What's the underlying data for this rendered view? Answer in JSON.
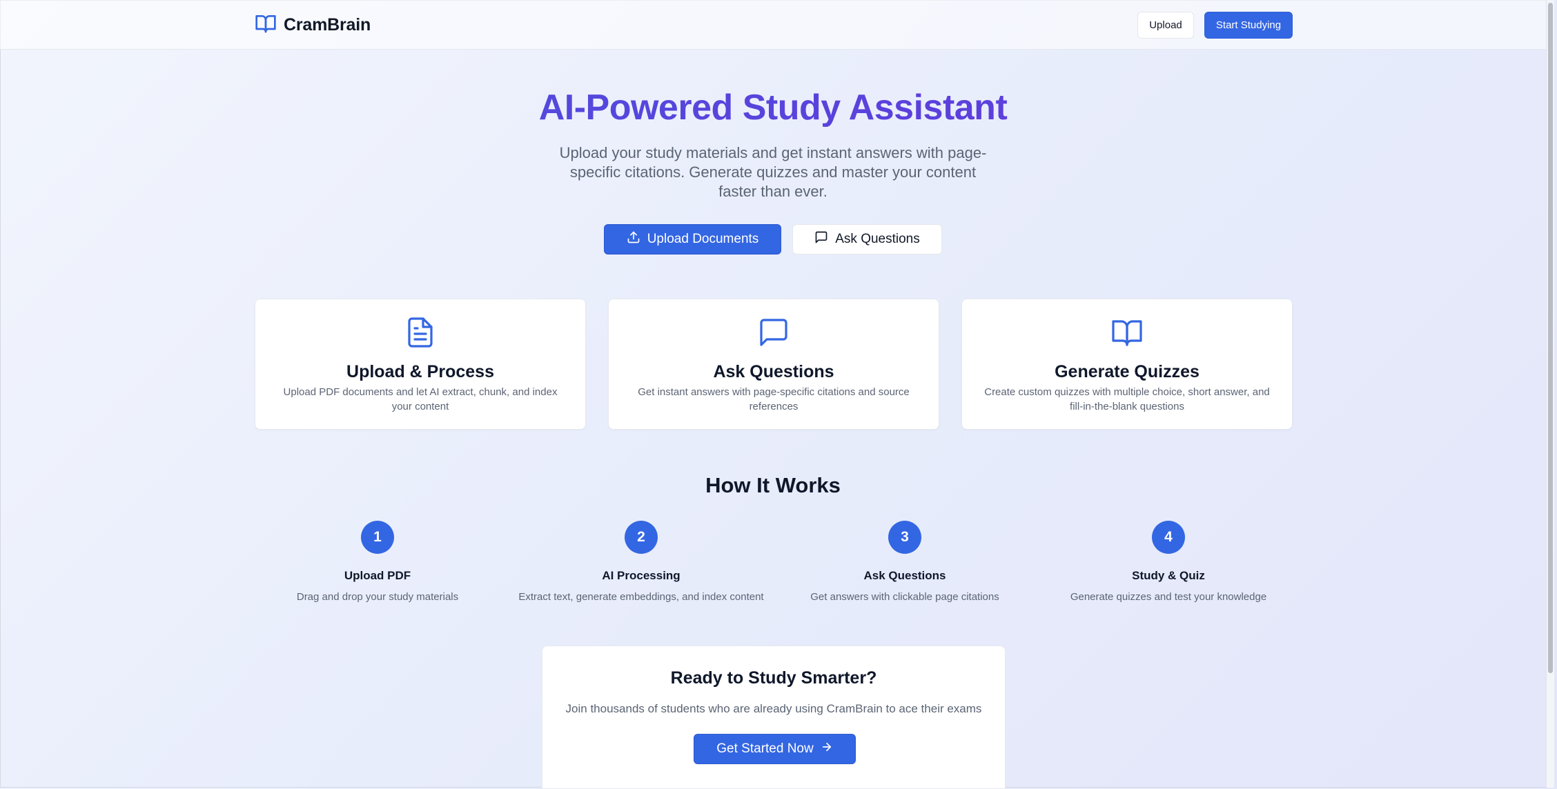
{
  "header": {
    "brand": "CramBrain",
    "upload_label": "Upload",
    "start_label": "Start Studying"
  },
  "hero": {
    "title": "AI-Powered Study Assistant",
    "subtitle": "Upload your study materials and get instant answers with page-specific citations. Generate quizzes and master your content faster than ever.",
    "upload_button": "Upload Documents",
    "ask_button": "Ask Questions"
  },
  "features": [
    {
      "icon": "file-text-icon",
      "title": "Upload & Process",
      "description": "Upload PDF documents and let AI extract, chunk, and index your content"
    },
    {
      "icon": "message-square-icon",
      "title": "Ask Questions",
      "description": "Get instant answers with page-specific citations and source references"
    },
    {
      "icon": "book-open-icon",
      "title": "Generate Quizzes",
      "description": "Create custom quizzes with multiple choice, short answer, and fill-in-the-blank questions"
    }
  ],
  "how_it_works": {
    "title": "How It Works",
    "steps": [
      {
        "number": "1",
        "title": "Upload PDF",
        "description": "Drag and drop your study materials"
      },
      {
        "number": "2",
        "title": "AI Processing",
        "description": "Extract text, generate embeddings, and index content"
      },
      {
        "number": "3",
        "title": "Ask Questions",
        "description": "Get answers with clickable page citations"
      },
      {
        "number": "4",
        "title": "Study & Quiz",
        "description": "Generate quizzes and test your knowledge"
      }
    ]
  },
  "cta": {
    "title": "Ready to Study Smarter?",
    "subtitle": "Join thousands of students who are already using CramBrain to ace their exams",
    "button": "Get Started Now"
  },
  "colors": {
    "accent": "#3366e2",
    "title_gradient_start": "#4a55de",
    "title_gradient_end": "#6a44e2",
    "muted_text": "#5b6474"
  }
}
